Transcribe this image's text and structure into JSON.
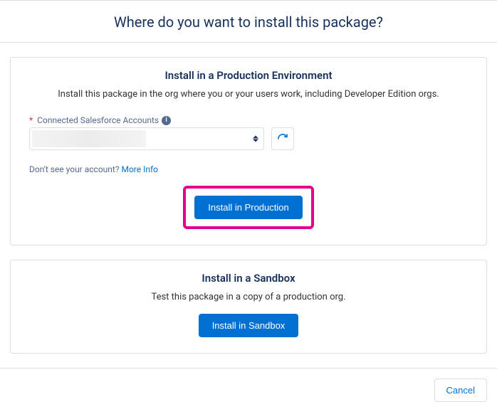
{
  "header": {
    "title": "Where do you want to install this package?"
  },
  "production": {
    "title": "Install in a Production Environment",
    "description": "Install this package in the org where you or your users work, including Developer Edition orgs.",
    "accounts_label": "Connected Salesforce Accounts",
    "hint_prefix": "Don't see your account? ",
    "hint_link": "More Info",
    "install_label": "Install in Production"
  },
  "sandbox": {
    "title": "Install in a Sandbox",
    "description": "Test this package in a copy of a production org.",
    "install_label": "Install in Sandbox"
  },
  "footer": {
    "cancel_label": "Cancel"
  }
}
